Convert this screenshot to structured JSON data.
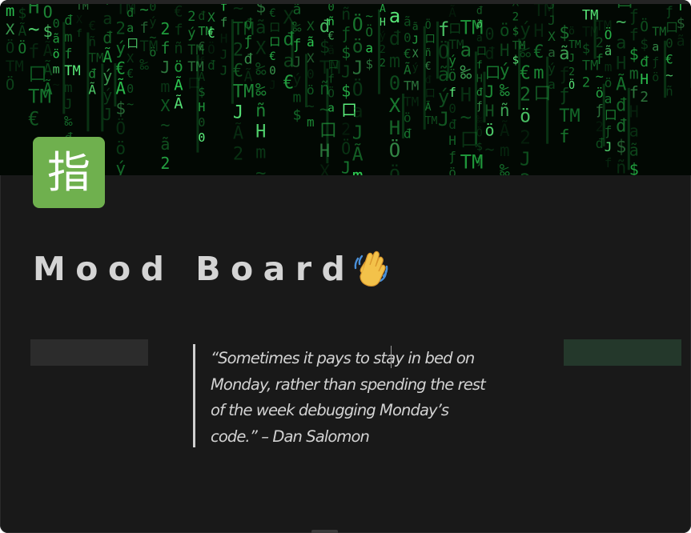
{
  "page": {
    "icon_glyph": "指",
    "icon_color": "#6fb04e",
    "title": "Mood Board",
    "title_emoji": "waving-hand",
    "background_color": "#191919"
  },
  "cover": {
    "description_icon": "matrix-code-cover",
    "accent_color": "#2fe35a",
    "glyphs": "dfJHan口X~ŕ˜TM‰ýẞ¢mÃƒö€0",
    "glyph_set": [
      "đ",
      "f",
      "J",
      "H",
      "a",
      "口",
      "X",
      "~",
      "ñ",
      "Ã",
      "TM",
      "ý",
      "m",
      "€",
      "Ö",
      "ƒ",
      "ö",
      "2",
      "0",
      "‰",
      "ã",
      "$"
    ]
  },
  "callouts": {
    "left_color": "#2c2c2c",
    "right_color": "#24382b"
  },
  "quote": {
    "lines": [
      "“Sometimes it pays to stay in bed on",
      "Monday, rather than spending the rest",
      "of the week debugging Monday’s",
      "code.” – Dan Salomon"
    ]
  }
}
